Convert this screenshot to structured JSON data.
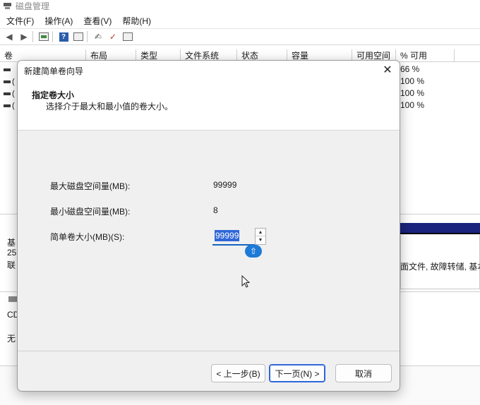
{
  "app": {
    "title": "磁盘管理"
  },
  "menu": [
    "文件(F)",
    "操作(A)",
    "查看(V)",
    "帮助(H)"
  ],
  "toolbar_icons": [
    "back-arrow-icon",
    "forward-arrow-icon",
    "console-tree-icon",
    "help-icon",
    "properties-icon",
    "connect-icon",
    "check-icon",
    "export-icon"
  ],
  "table": {
    "columns": [
      "卷",
      "布局",
      "类型",
      "文件系统",
      "状态",
      "容量",
      "可用空间",
      "% 可用"
    ],
    "volume_markers": [
      "",
      "(",
      "(",
      "("
    ],
    "percent_free": [
      "66 %",
      "100 %",
      "100 %",
      "100 %"
    ]
  },
  "lower": {
    "disk_labels": [
      "基",
      "25",
      "联"
    ],
    "cd_label": "CD",
    "cd_status": "无",
    "partition_text": "面文件, 故障转储, 基本"
  },
  "dialog": {
    "title": "新建简单卷向导",
    "close": "✕",
    "header_title": "指定卷大小",
    "header_subtitle": "选择介于最大和最小值的卷大小。",
    "max_label": "最大磁盘空间量(MB):",
    "max_value": "99999",
    "min_label": "最小磁盘空间量(MB):",
    "min_value": "8",
    "size_label": "简单卷大小(MB)(S):",
    "size_value": "99999",
    "ime_glyph": "⇧",
    "back_button": "< 上一步(B)",
    "next_button": "下一页(N) >",
    "cancel_button": "取消"
  },
  "colors": {
    "accent": "#2f67d8",
    "disk_bar": "#1a237e"
  }
}
